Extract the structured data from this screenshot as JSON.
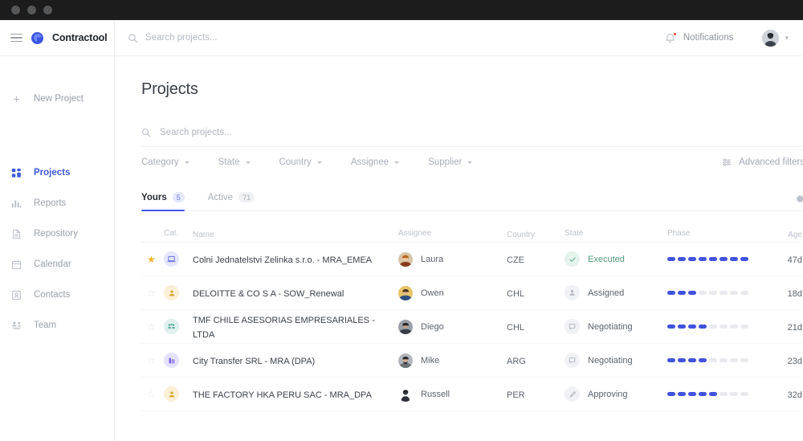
{
  "window": {
    "dots": 3
  },
  "sidebar": {
    "brand": "Contractool",
    "new_project": "New Project",
    "items": [
      {
        "label": "Projects",
        "icon": "grid-icon",
        "active": true
      },
      {
        "label": "Reports",
        "icon": "bar-chart-icon",
        "active": false
      },
      {
        "label": "Repository",
        "icon": "document-icon",
        "active": false
      },
      {
        "label": "Calendar",
        "icon": "calendar-icon",
        "active": false
      },
      {
        "label": "Contacts",
        "icon": "contact-icon",
        "active": false
      },
      {
        "label": "Team",
        "icon": "team-icon",
        "active": false
      }
    ]
  },
  "topbar": {
    "search_placeholder": "Search projects...",
    "notifications_label": "Notifications",
    "has_notification_badge": true
  },
  "page": {
    "title": "Projects",
    "search_placeholder": "Search projects...",
    "filters": [
      "Category",
      "State",
      "Country",
      "Assignee",
      "Supplier"
    ],
    "advanced_filters_label": "Advanced filters",
    "tabs": [
      {
        "label": "Yours",
        "count": "5",
        "active": true
      },
      {
        "label": "Active",
        "count": "71",
        "active": false
      }
    ]
  },
  "table": {
    "columns": [
      "Cat.",
      "Name",
      "Assignee",
      "Country",
      "State",
      "Phase",
      "Age"
    ],
    "phase_total": 8,
    "rows": [
      {
        "starred": true,
        "category_icon": "laptop-icon",
        "category_color": "#e5e6fb",
        "category_glyph_color": "#6b6fe0",
        "name": "Colni Jednatelstvi Zelinka s.r.o. - MRA_EMEA",
        "assignee": "Laura",
        "avatar_color": "#b5651d",
        "country": "CZE",
        "state": "Executed",
        "state_icon": "check-icon",
        "state_ok": true,
        "phase_filled": 8,
        "age": "47d"
      },
      {
        "starred": false,
        "category_icon": "person-badge-icon",
        "category_color": "#fbf0d6",
        "category_glyph_color": "#d9a227",
        "name": "DELOITTE & CO S A - SOW_Renewal",
        "assignee": "Owen",
        "avatar_color": "#d7a13a",
        "country": "CHL",
        "state": "Assigned",
        "state_icon": "person-icon",
        "state_ok": false,
        "phase_filled": 3,
        "age": "18d"
      },
      {
        "starred": false,
        "category_icon": "group-icon",
        "category_color": "#dff0ee",
        "category_glyph_color": "#47a08f",
        "name": "TMF CHILE ASESORIAS EMPRESARIALES - LTDA",
        "assignee": "Diego",
        "avatar_color": "#5a5f68",
        "country": "CHL",
        "state": "Negotiating",
        "state_icon": "chat-icon",
        "state_ok": false,
        "phase_filled": 4,
        "age": "21d"
      },
      {
        "starred": false,
        "category_icon": "folder-icon",
        "category_color": "#e4e2fb",
        "category_glyph_color": "#7a5de8",
        "name": "City Transfer SRL - MRA (DPA)",
        "assignee": "Mike",
        "avatar_color": "#8d9199",
        "country": "ARG",
        "state": "Negotiating",
        "state_icon": "chat-icon",
        "state_ok": false,
        "phase_filled": 4,
        "age": "23d"
      },
      {
        "starred": false,
        "category_icon": "person-badge-icon",
        "category_color": "#fbf0d6",
        "category_glyph_color": "#d9a227",
        "name": "THE FACTORY HKA PERU SAC - MRA_DPA",
        "assignee": "Russell",
        "avatar_color": "#3a3f47",
        "country": "PER",
        "state": "Approving",
        "state_icon": "signature-icon",
        "state_ok": false,
        "phase_filled": 5,
        "age": "32d"
      }
    ]
  },
  "colors": {
    "accent": "#4058e3",
    "accent_dot": "#4052dd",
    "success": "#4f9c79",
    "star": "#f0b429",
    "notification": "#f0453a",
    "muted_text": "#9ba1ab"
  }
}
